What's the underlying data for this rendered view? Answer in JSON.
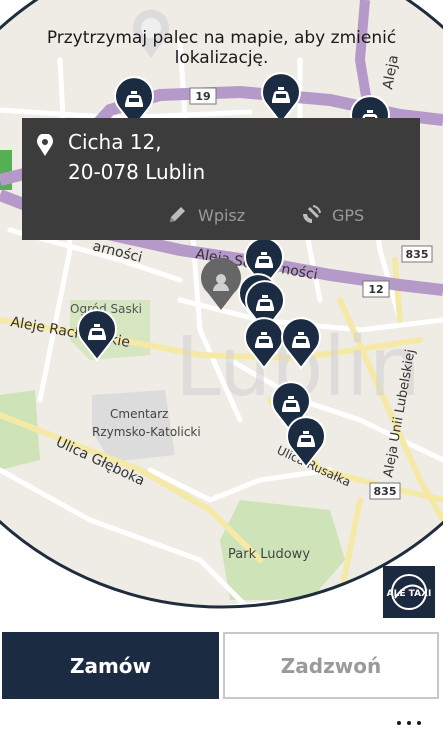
{
  "instruction": "Przytrzymaj palec na mapie, aby zmienić lokalizację.",
  "location": {
    "line1": "Cicha 12,",
    "line2": "20-078 Lublin"
  },
  "card_actions": {
    "wpisz_label": "Wpisz",
    "gps_label": "GPS"
  },
  "map": {
    "labels": {
      "aleja_top": "Aleja",
      "aleja_solidarnosci_left": "arności",
      "aleja_solidarnosci": "Aleja Solidarności",
      "ogrod_saski": "Ogród Saski",
      "aleje_raclawickie": "Aleje Racławickie",
      "cmentarz_1": "Cmentarz",
      "cmentarz_2": "Rzymsko-Katolicki",
      "ulica_gleboka": "Ulica Głęboka",
      "park_ludowy": "Park Ludowy",
      "aleja_unii": "Aleja Unii Lubelskiej",
      "ulica_rusalka": "Ulica Rusałka",
      "city_watermark": "Lublin",
      "ska": "ska"
    },
    "road_badges": {
      "b19": "19",
      "b835_top": "835",
      "b12": "12",
      "b835_bottom": "835"
    },
    "taxi_count": 11
  },
  "logo": {
    "text": "ALE TAXI"
  },
  "actions": {
    "order_label": "Zamów",
    "call_label": "Zadzwoń"
  },
  "colors": {
    "primary": "#1a2b42",
    "card_bg": "#3c3c3c",
    "main_road": "#b59ac9",
    "ring": "#1f2d3d"
  }
}
